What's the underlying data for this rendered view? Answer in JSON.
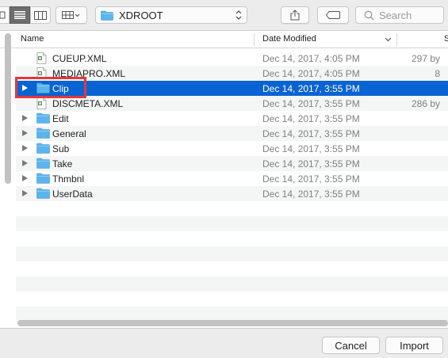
{
  "toolbar": {
    "location": "XDROOT",
    "search_placeholder": "Search"
  },
  "columns": {
    "name": "Name",
    "date": "Date Modified",
    "size": "S"
  },
  "rows": [
    {
      "name": "CUEUP.XML",
      "date": "Dec 14, 2017, 4:05 PM",
      "size": "297 by",
      "kind": "file"
    },
    {
      "name": "MEDIAPRO.XML",
      "date": "Dec 14, 2017, 4:05 PM",
      "size": "8",
      "kind": "file"
    },
    {
      "name": "Clip",
      "date": "Dec 14, 2017, 3:55 PM",
      "size": "",
      "kind": "folder",
      "selected": true
    },
    {
      "name": "DISCMETA.XML",
      "date": "Dec 14, 2017, 3:55 PM",
      "size": "286 by",
      "kind": "file"
    },
    {
      "name": "Edit",
      "date": "Dec 14, 2017, 3:55 PM",
      "size": "",
      "kind": "folder"
    },
    {
      "name": "General",
      "date": "Dec 14, 2017, 3:55 PM",
      "size": "",
      "kind": "folder"
    },
    {
      "name": "Sub",
      "date": "Dec 14, 2017, 3:55 PM",
      "size": "",
      "kind": "folder"
    },
    {
      "name": "Take",
      "date": "Dec 14, 2017, 3:55 PM",
      "size": "",
      "kind": "folder"
    },
    {
      "name": "Thmbnl",
      "date": "Dec 14, 2017, 3:55 PM",
      "size": "",
      "kind": "folder"
    },
    {
      "name": "UserData",
      "date": "Dec 14, 2017, 3:55 PM",
      "size": "",
      "kind": "folder"
    }
  ],
  "buttons": {
    "cancel": "Cancel",
    "import": "Import"
  },
  "colors": {
    "selection": "#0a63d2",
    "folder": "#5cb4ec",
    "highlight": "#e03a3a"
  },
  "icons": [
    "column-view-icon",
    "list-view-icon",
    "columns-view-icon",
    "gallery-grid-icon",
    "folder-icon",
    "up-down-arrows-icon",
    "share-icon",
    "tag-icon",
    "search-icon",
    "disclosure-triangle-icon",
    "xml-file-icon"
  ]
}
